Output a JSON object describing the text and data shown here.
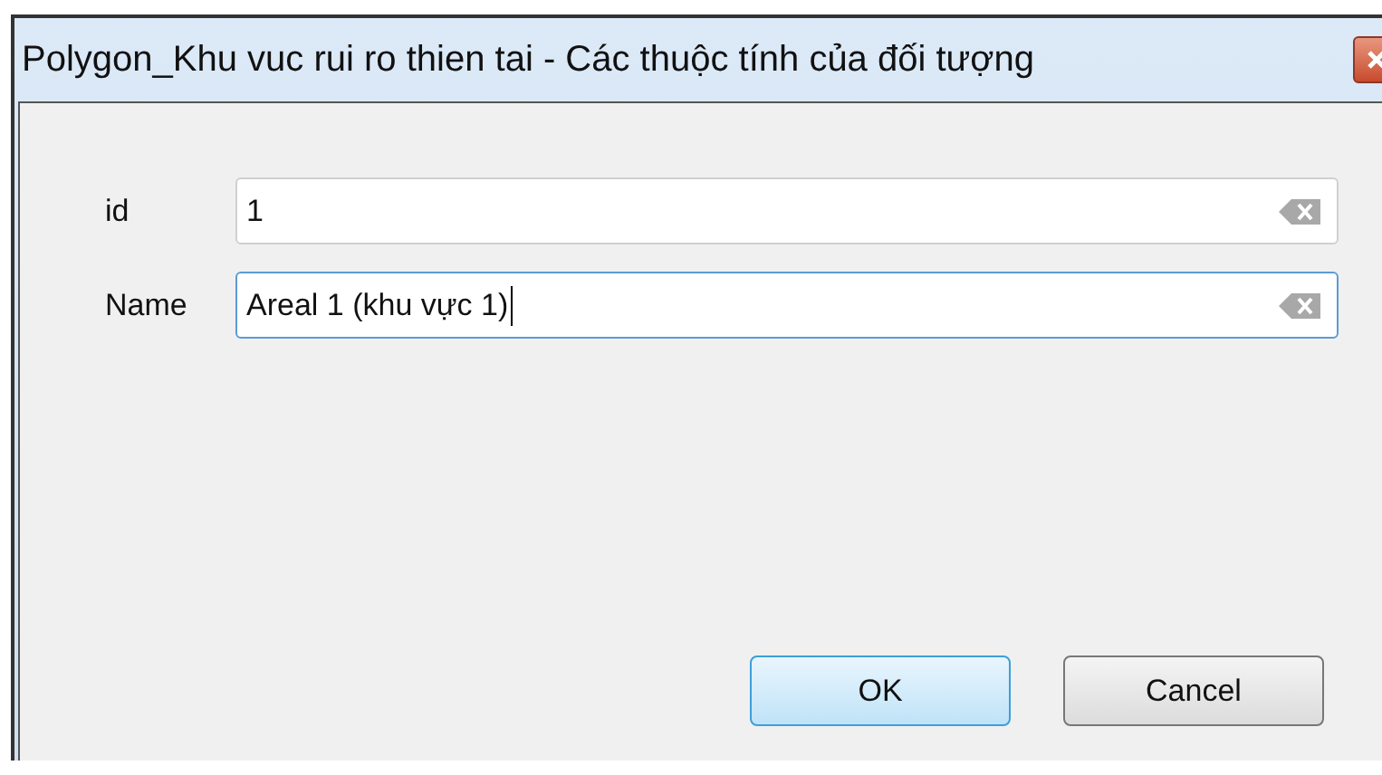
{
  "window": {
    "title": "Polygon_Khu vuc rui ro thien tai - Các thuộc tính của đối tượng"
  },
  "fields": [
    {
      "label": "id",
      "value": "1",
      "focused": false
    },
    {
      "label": "Name",
      "value": "Areal 1 (khu vực 1)",
      "focused": true
    }
  ],
  "buttons": [
    {
      "label": "OK",
      "default": true
    },
    {
      "label": "Cancel",
      "default": false
    }
  ]
}
